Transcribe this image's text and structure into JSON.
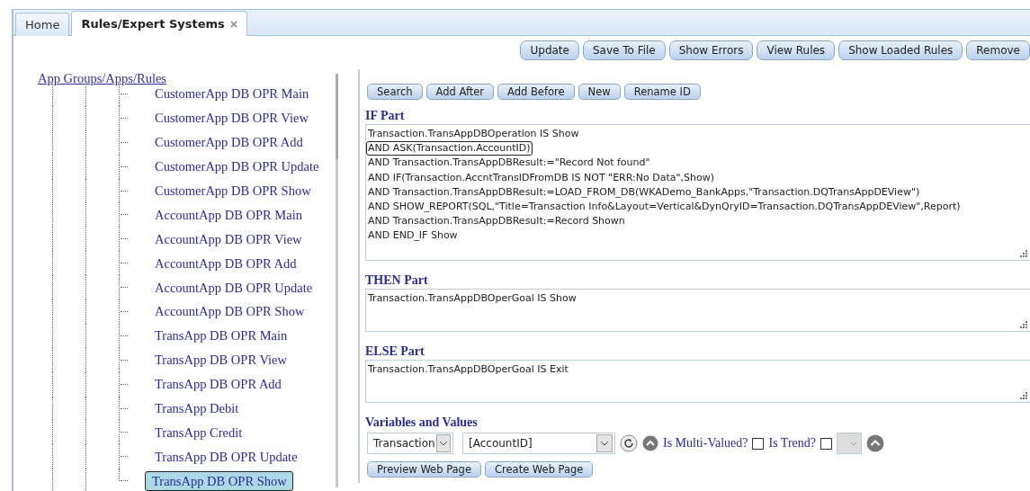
{
  "tabs": [
    {
      "label": "Home",
      "selected": false,
      "closable": false
    },
    {
      "label": "Rules/Expert Systems",
      "selected": true,
      "closable": true
    }
  ],
  "toolbar": {
    "buttons": [
      "Update",
      "Save To File",
      "Show Errors",
      "View Rules",
      "Show Loaded Rules",
      "Remove"
    ]
  },
  "tree": {
    "root": "App Groups/Apps/Rules",
    "items": [
      {
        "label": "CustomerApp DB OPR Main",
        "selected": false
      },
      {
        "label": "CustomerApp DB OPR View",
        "selected": false
      },
      {
        "label": "CustomerApp DB OPR Add",
        "selected": false
      },
      {
        "label": "CustomerApp DB OPR Update",
        "selected": false
      },
      {
        "label": "CustomerApp DB OPR Show",
        "selected": false
      },
      {
        "label": "AccountApp DB OPR Main",
        "selected": false
      },
      {
        "label": "AccountApp DB OPR View",
        "selected": false
      },
      {
        "label": "AccountApp DB OPR Add",
        "selected": false
      },
      {
        "label": "AccountApp DB OPR Update",
        "selected": false
      },
      {
        "label": "AccountApp DB OPR Show",
        "selected": false
      },
      {
        "label": "TransApp DB OPR Main",
        "selected": false
      },
      {
        "label": "TransApp DB OPR View",
        "selected": false
      },
      {
        "label": "TransApp DB OPR Add",
        "selected": false
      },
      {
        "label": "TransApp Debit",
        "selected": false
      },
      {
        "label": "TransApp Credit",
        "selected": false
      },
      {
        "label": "TransApp DB OPR Update",
        "selected": false
      },
      {
        "label": "TransApp DB OPR Show",
        "selected": true
      }
    ]
  },
  "editor": {
    "buttons": [
      "Search",
      "Add After",
      "Add Before",
      "New",
      "Rename ID"
    ],
    "sections": [
      {
        "title": "IF Part",
        "lines": [
          {
            "text": "Transaction.TransAppDBOperation IS Show",
            "highlighted": false
          },
          {
            "text": "AND ASK(Transaction.AccountID)",
            "highlighted": true
          },
          {
            "text": "AND Transaction.TransAppDBResult:=\"Record Not found\"",
            "highlighted": false
          },
          {
            "text": "AND IF(Transaction.AccntTransIDFromDB IS NOT \"ERR:No Data\",Show)",
            "highlighted": false
          },
          {
            "text": "AND Transaction.TransAppDBResult:=LOAD_FROM_DB(WKADemo_BankApps,\"Transaction.DQTransAppDEView\")",
            "highlighted": false
          },
          {
            "text": "AND SHOW_REPORT(SQL,\"Title=Transaction Info&Layout=Vertical&DynQryID=Transaction.DQTransAppDEView\",Report)",
            "highlighted": false
          },
          {
            "text": "AND Transaction.TransAppDBResult:=Record Shown",
            "highlighted": false
          },
          {
            "text": "AND END_IF Show",
            "highlighted": false
          }
        ]
      },
      {
        "title": "THEN Part",
        "lines": [
          {
            "text": "Transaction.TransAppDBOperGoal IS Show",
            "highlighted": false
          }
        ]
      },
      {
        "title": "ELSE Part",
        "lines": [
          {
            "text": "Transaction.TransAppDBOperGoal IS Exit",
            "highlighted": false
          }
        ]
      }
    ]
  },
  "variables": {
    "title": "Variables and Values",
    "group_select": {
      "value": "Transaction"
    },
    "variable_select": {
      "value": "[AccountID]"
    },
    "multi_valued": {
      "label": "Is Multi-Valued?",
      "checked": false
    },
    "trend": {
      "label": "Is Trend?",
      "checked": false
    },
    "value_select": {
      "disabled": true
    }
  },
  "bottom_buttons": [
    "Preview Web Page",
    "Create Web Page"
  ]
}
